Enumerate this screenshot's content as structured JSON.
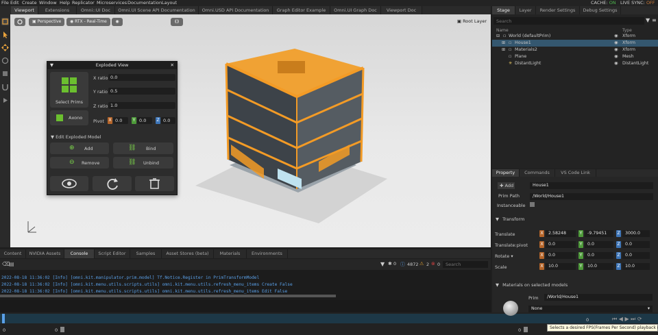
{
  "menu": {
    "items": [
      "File",
      "Edit",
      "Create",
      "Window",
      "Help",
      "Replicator",
      "Microservices",
      "Documentation",
      "Layout"
    ],
    "cache_label": "CACHE:",
    "cache_value": "ON",
    "live_sync_label": "LIVE SYNC:",
    "live_sync_value": "OFF"
  },
  "doc_tabs": [
    "Viewport",
    "Extensions",
    "Omni::UI Doc",
    "Omni.UI Scene API Documentation",
    "Omni.USD API Documentation",
    "Graph Editor Example",
    "Omni.UI Graph Doc",
    "Viewport Doc"
  ],
  "viewport": {
    "perspective_label": "Perspective",
    "renderer_label": "RTX - Real-Time",
    "root_layer_label": "Root Layer"
  },
  "exploded_view": {
    "title": "Exploded View",
    "select_prims_label": "Select Prims",
    "axono_label": "Axono",
    "x_ratio_label": "X ratio",
    "x_ratio_value": "0.0",
    "y_ratio_label": "Y ratio",
    "y_ratio_value": "0.5",
    "z_ratio_label": "Z ratio",
    "z_ratio_value": "1.0",
    "pivot_label": "Pivot",
    "pivot_x": "0.0",
    "pivot_y": "0.0",
    "pivot_z": "0.0",
    "edit_section_label": "Edit Exploded Model",
    "add_label": "Add",
    "bind_label": "Bind",
    "remove_label": "Remove",
    "unbind_label": "Unbind"
  },
  "bottom_tabs": [
    "Content",
    "NVIDIA Assets",
    "Console",
    "Script Editor",
    "Samples",
    "Asset Stores (beta)",
    "Materials",
    "Environments"
  ],
  "console": {
    "count_info": "4872",
    "count_warn": "2",
    "count_error": "0",
    "search_placeholder": "Search",
    "lines": [
      "2022-08-18 11:36:02  [Info] [omni.kit.manipulator.prim.model] Tf.Notice.Register in PrimTransformModel",
      "2022-08-18 11:36:02  [Info] [omni.kit.menu.utils.scripts.utils] omni.kit.menu.utils.refresh_menu_items Create False",
      "2022-08-18 11:36:02  [Info] [omni.kit.menu.utils.scripts.utils] omni.kit.menu.utils.refresh_menu_items Edit False"
    ]
  },
  "timeline": {
    "start": "0",
    "current": "0",
    "end": "0",
    "tooltip": "Selects a desired FPS(Frames Per Second) playback rate"
  },
  "right_tabs": [
    "Stage",
    "Layer",
    "Render Settings",
    "Debug Settings"
  ],
  "stage": {
    "search_placeholder": "Search",
    "col_name": "Name",
    "col_type": "Type",
    "rows": [
      {
        "name": "World (defaultPrim)",
        "type": "Xform"
      },
      {
        "name": "House1",
        "type": "Xform"
      },
      {
        "name": "Materials2",
        "type": "Xform"
      },
      {
        "name": "Plane",
        "type": "Mesh"
      },
      {
        "name": "DistantLight",
        "type": "DistantLight"
      }
    ]
  },
  "prop_tabs": [
    "Property",
    "Commands",
    "VS Code Link"
  ],
  "property": {
    "add_label": "Add",
    "prim_name": "House1",
    "prim_path_label": "Prim Path",
    "prim_path": "/World/House1",
    "instanceable_label": "Instanceable",
    "transform_label": "Transform",
    "translate_label": "Translate",
    "translate": [
      "2.58248",
      "-9.79451",
      "3000.0"
    ],
    "translate_pivot_label": "Translate:pivot",
    "translate_pivot": [
      "0.0",
      "0.0",
      "0.0"
    ],
    "rotate_label": "Rotate",
    "rotate": [
      "0.0",
      "0.0",
      "0.0"
    ],
    "scale_label": "Scale",
    "scale": [
      "10.0",
      "10.0",
      "10.0"
    ],
    "materials_label": "Materials on selected models",
    "prim_label": "Prim",
    "mat_prim": "/World/House1",
    "none_label": "None"
  }
}
